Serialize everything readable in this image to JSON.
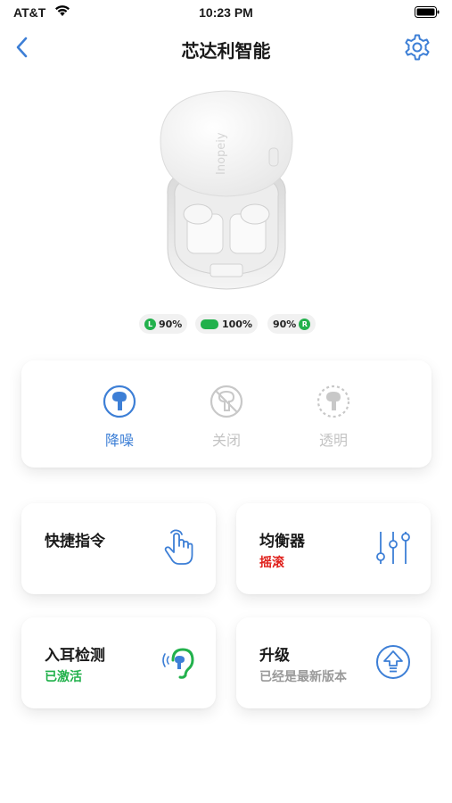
{
  "status_bar": {
    "carrier": "AT&T",
    "time": "10:23 PM"
  },
  "nav": {
    "title": "芯达利智能"
  },
  "product": {
    "brand_watermark": "Inopeiy"
  },
  "battery": {
    "left": {
      "tag": "L",
      "value": "90%"
    },
    "case": {
      "value": "100%"
    },
    "right": {
      "tag": "R",
      "value": "90%"
    }
  },
  "anc_modes": [
    {
      "label": "降噪",
      "icon": "anc-icon",
      "active": true
    },
    {
      "label": "关闭",
      "icon": "anc-off-icon",
      "active": false
    },
    {
      "label": "透明",
      "icon": "transparency-icon",
      "active": false
    }
  ],
  "tiles": {
    "shortcuts": {
      "title": "快捷指令",
      "subtitle": "",
      "icon": "touch-gesture-icon"
    },
    "equalizer": {
      "title": "均衡器",
      "subtitle": "摇滚",
      "icon": "equalizer-sliders-icon"
    },
    "ear_detection": {
      "title": "入耳检测",
      "subtitle": "已激活",
      "icon": "ear-detection-icon"
    },
    "upgrade": {
      "title": "升级",
      "subtitle": "已经是最新版本",
      "icon": "upgrade-arrow-icon"
    }
  },
  "colors": {
    "accent_blue": "#3d7fd6",
    "battery_green": "#22b14c",
    "eq_red": "#e0201b",
    "active_green": "#22b14c",
    "inactive_gray": "#c4c4c4",
    "muted_gray": "#9a9a9a"
  }
}
